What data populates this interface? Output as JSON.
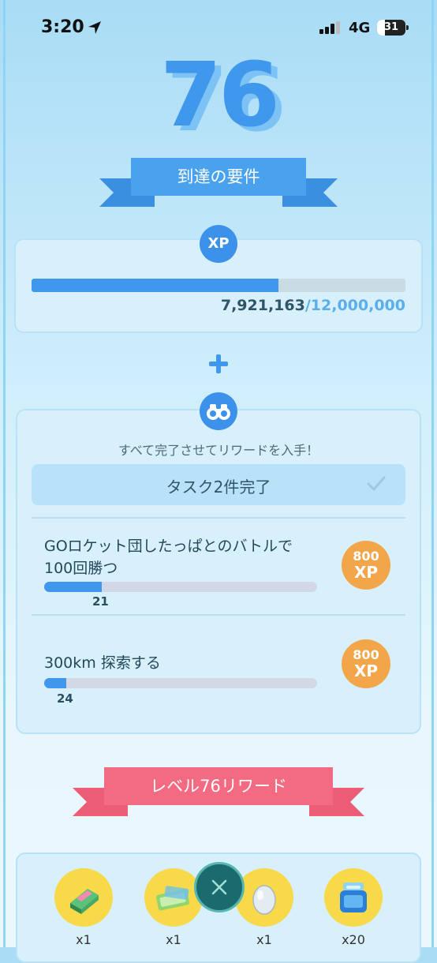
{
  "status_bar": {
    "time": "3:20",
    "network": "4G",
    "battery": "31"
  },
  "level": {
    "number": "76"
  },
  "requirements": {
    "ribbon_label": "到達の要件",
    "xp_badge": "XP",
    "xp_current": "7,921,163",
    "xp_separator": "/",
    "xp_goal": "12,000,000",
    "xp_progress_fraction": 0.66
  },
  "tasks": {
    "header": "すべて完了させてリワードを入手！",
    "completed_label": "タスク2件完了",
    "items": [
      {
        "title": "GOロケット団したっぱとのバトルで100回勝つ",
        "count": "21",
        "progress_fraction": 0.21,
        "reward_amount": "800",
        "reward_unit": "XP"
      },
      {
        "title": "300km 探索する",
        "count": "24",
        "progress_fraction": 0.08,
        "reward_amount": "800",
        "reward_unit": "XP"
      }
    ]
  },
  "rewards": {
    "ribbon_label": "レベル76リワード",
    "items": [
      {
        "icon": "incense-icon",
        "qty": "x1"
      },
      {
        "icon": "ticket-icon",
        "qty": "x1"
      },
      {
        "icon": "egg-icon",
        "qty": "x1"
      },
      {
        "icon": "potion-icon",
        "qty": "x20"
      }
    ]
  },
  "colors": {
    "primary_blue": "#3f98ec",
    "reward_orange": "#f3a54a",
    "ribbon_pink": "#f0607a",
    "item_yellow": "#f7d94a"
  }
}
